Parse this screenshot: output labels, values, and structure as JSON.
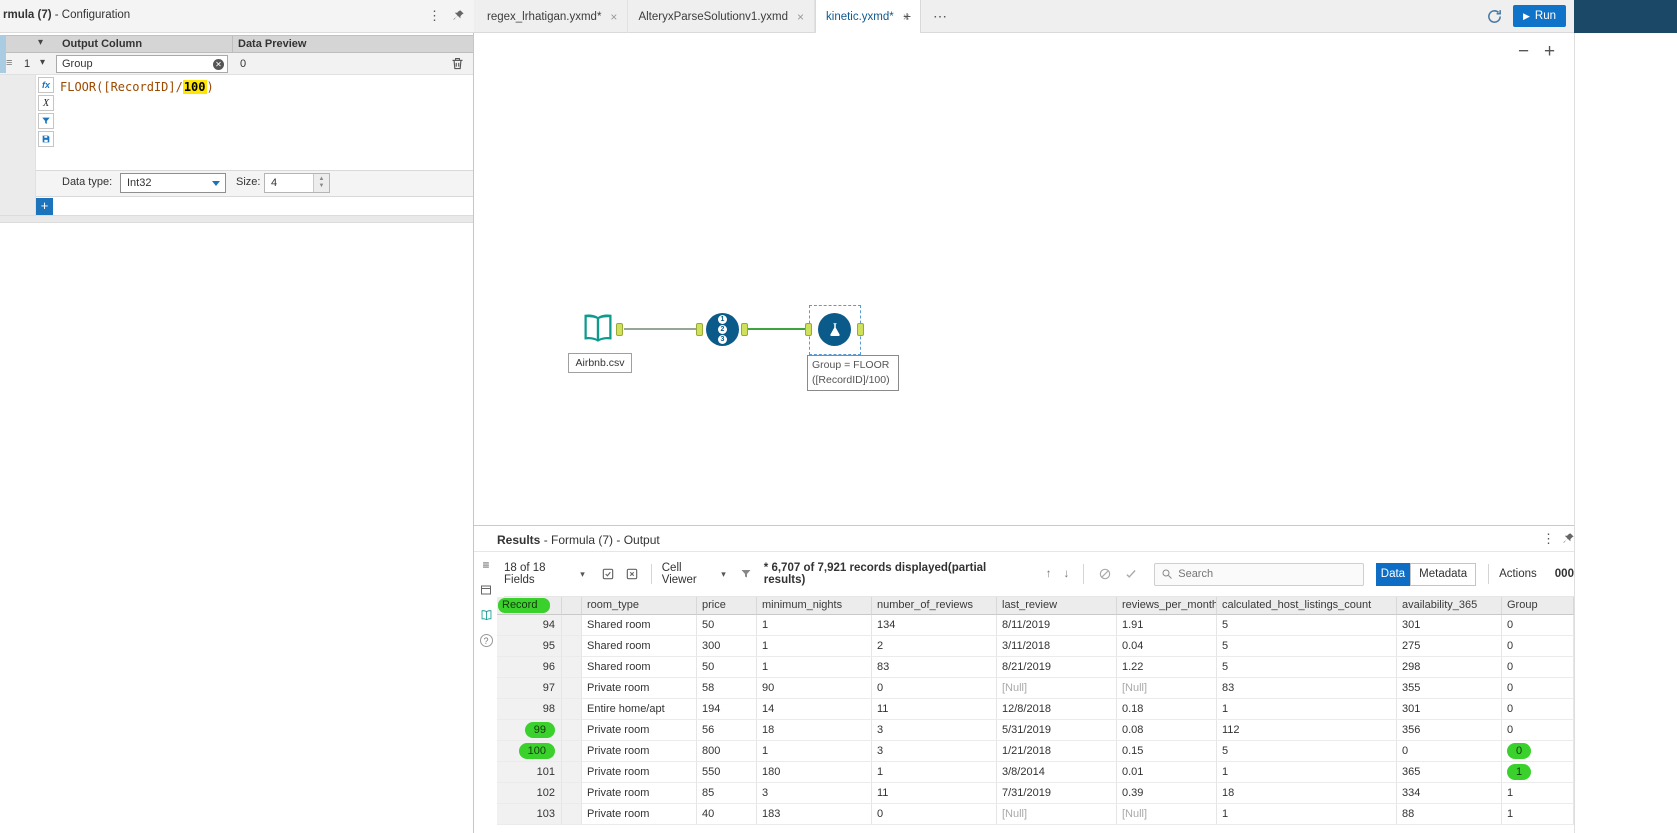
{
  "window": {
    "config_title_bold": "rmula (7)",
    "config_title_rest": " - Configuration",
    "run_label": "Run"
  },
  "tabs": {
    "items": [
      {
        "label": "regex_lrhatigan.yxmd*",
        "active": false
      },
      {
        "label": "AlteryxParseSolutionv1.yxmd",
        "active": false
      },
      {
        "label": "kinetic.yxmd*",
        "active": true
      }
    ],
    "new_tab": "+",
    "overflow": "⋯"
  },
  "config": {
    "header": {
      "output_column": "Output Column",
      "data_preview": "Data Preview"
    },
    "row": {
      "index": "1",
      "field": "Group",
      "preview": "0"
    },
    "expression": {
      "pre": "FLOOR([RecordID]/",
      "hl": "100",
      "post": ")"
    },
    "datatype_label": "Data type:",
    "datatype_value": "Int32",
    "size_label": "Size:",
    "size_value": "4",
    "add_button": "+"
  },
  "canvas": {
    "zoom_out": "−",
    "zoom_in": "+",
    "input_label": "Airbnb.csv",
    "recordid_digits": [
      "1",
      "2",
      "3"
    ],
    "annotation": [
      "Group = FLOOR",
      "([RecordID]/100)"
    ]
  },
  "results": {
    "title_bold": "Results",
    "title_rest": " - Formula (7) - Output",
    "fields_summary": "18 of 18 Fields",
    "cell_viewer": "Cell Viewer",
    "record_summary": "* 6,707 of 7,921 records displayed(partial results)",
    "search_placeholder": "Search",
    "data_button": "Data",
    "metadata_button": "Metadata",
    "actions_label": "Actions",
    "actions_badge": "000",
    "columns": [
      "Record",
      "",
      "room_type",
      "price",
      "minimum_nights",
      "number_of_reviews",
      "last_review",
      "reviews_per_month",
      "calculated_host_listings_count",
      "availability_365",
      "Group"
    ],
    "rows": [
      [
        "94",
        "Shared room",
        "50",
        "1",
        "134",
        "8/11/2019",
        "1.91",
        "5",
        "301",
        "0"
      ],
      [
        "95",
        "Shared room",
        "300",
        "1",
        "2",
        "3/11/2018",
        "0.04",
        "5",
        "275",
        "0"
      ],
      [
        "96",
        "Shared room",
        "50",
        "1",
        "83",
        "8/21/2019",
        "1.22",
        "5",
        "298",
        "0"
      ],
      [
        "97",
        "Private room",
        "58",
        "90",
        "0",
        "[Null]",
        "[Null]",
        "83",
        "355",
        "0"
      ],
      [
        "98",
        "Entire home/apt",
        "194",
        "14",
        "11",
        "12/8/2018",
        "0.18",
        "1",
        "301",
        "0"
      ],
      [
        "99",
        "Private room",
        "56",
        "18",
        "3",
        "5/31/2019",
        "0.08",
        "112",
        "356",
        "0"
      ],
      [
        "100",
        "Private room",
        "800",
        "1",
        "3",
        "1/21/2018",
        "0.15",
        "5",
        "0",
        "0"
      ],
      [
        "101",
        "Private room",
        "550",
        "180",
        "1",
        "3/8/2014",
        "0.01",
        "1",
        "365",
        "1"
      ],
      [
        "102",
        "Private room",
        "85",
        "3",
        "11",
        "7/31/2019",
        "0.39",
        "18",
        "334",
        "1"
      ],
      [
        "103",
        "Private room",
        "40",
        "183",
        "0",
        "[Null]",
        "[Null]",
        "1",
        "88",
        "1"
      ]
    ],
    "highlights": {
      "header_column": "Record",
      "record_rows": [
        "99",
        "100"
      ],
      "group_rows": [
        "100",
        "101"
      ]
    }
  }
}
